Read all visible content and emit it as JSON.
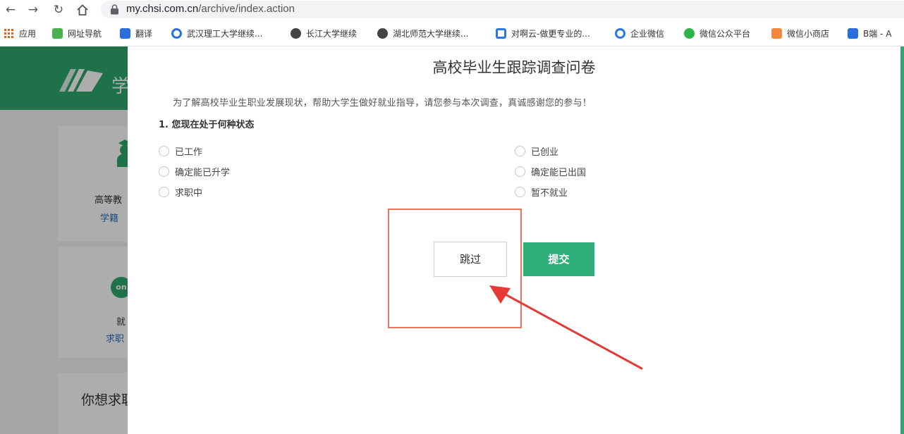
{
  "browser": {
    "url_host": "my.chsi.com.cn",
    "url_path": "/archive/index.action",
    "bookmarks": [
      {
        "label": "应用",
        "color": "#e0641e"
      },
      {
        "label": "网址导航",
        "color": "#4caf50"
      },
      {
        "label": "翻译",
        "color": "#2b6dd9"
      },
      {
        "label": "武汉理工大学继续...",
        "color": "#2b6dd9"
      },
      {
        "label": "长江大学继续",
        "color": "#333333"
      },
      {
        "label": "湖北师范大学继续...",
        "color": "#333333"
      },
      {
        "label": "对啊云-做更专业的...",
        "color": "#2b78e4"
      },
      {
        "label": "企业微信",
        "color": "#2b78e4"
      },
      {
        "label": "微信公众平台",
        "color": "#2cb34a"
      },
      {
        "label": "微信小商店",
        "color": "#f0883e"
      },
      {
        "label": "B端 - A",
        "color": "#2b6dd9"
      }
    ]
  },
  "site": {
    "logo_text": "学",
    "card1": {
      "text": "高等教",
      "link": "学籍"
    },
    "card2": {
      "badge": "on",
      "text": "就",
      "link": "求职"
    },
    "card3": {
      "text": "你想求职"
    }
  },
  "survey": {
    "title": "高校毕业生跟踪调查问卷",
    "intro": "为了解高校毕业生职业发展现状，帮助大学生做好就业指导，请您参与本次调查，真诚感谢您的参与！",
    "question": "1. 您现在处于何种状态",
    "options_left": [
      "已工作",
      "确定能已升学",
      "求职中"
    ],
    "options_right": [
      "已创业",
      "确定能已出国",
      "暂不就业"
    ],
    "skip_label": "跳过",
    "submit_label": "提交"
  },
  "colors": {
    "brand_green": "#2fa76e",
    "submit_green": "#2fb07a",
    "highlight": "#e8765d",
    "arrow": "#e53935"
  }
}
